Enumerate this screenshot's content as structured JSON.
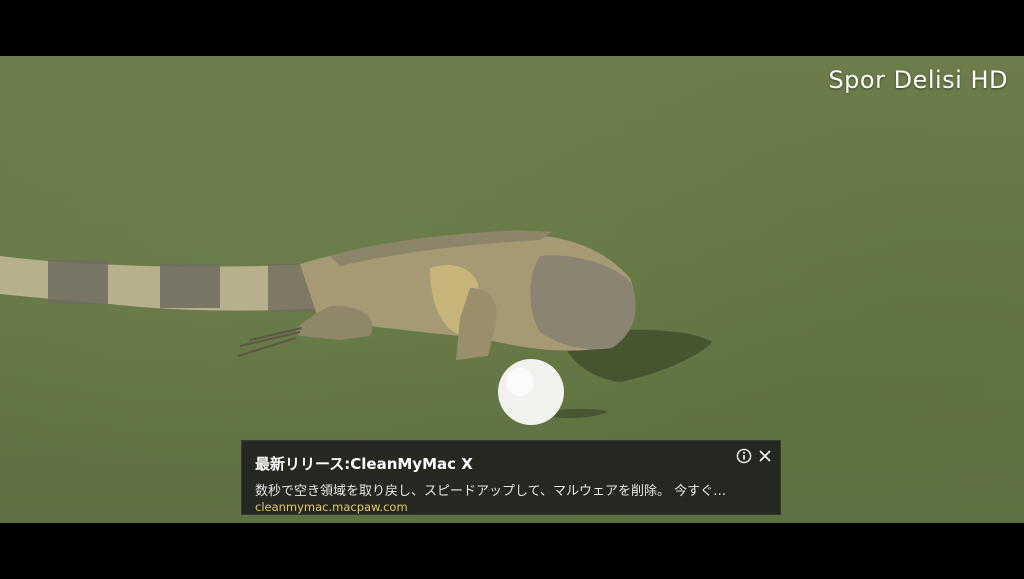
{
  "video": {
    "watermark": "Spor Delisi HD"
  },
  "ad": {
    "title": "最新リリース:CleanMyMac X",
    "description": "数秒で空き領域を取り戻し、スピードアップして、マルウェアを削除。 今すぐ…",
    "url": "cleanmymac.macpaw.com",
    "info_icon": "info-icon",
    "close_icon": "close-icon"
  },
  "colors": {
    "letterbox": "#000000",
    "grass": "#667847",
    "ad_background": "#1c1c1c",
    "ad_url": "#e8c766"
  }
}
